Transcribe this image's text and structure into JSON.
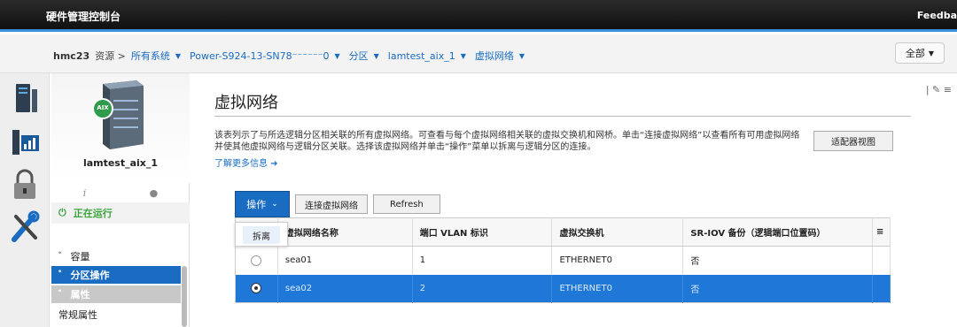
{
  "app": {
    "title": "硬件管理控制台",
    "feedback": "Feedba"
  },
  "breadcrumb": {
    "host": "hmc23",
    "resources": "资源 >",
    "items": [
      "所有系统",
      "Power-S924-13-SN78⁻⁻⁻⁻⁻⁻0",
      "分区",
      "lamtest_aix_1",
      "虚拟网络"
    ]
  },
  "scope": {
    "value": "全部"
  },
  "partition": {
    "name": "lamtest_aix_1",
    "status": "正在运行",
    "badge": "AIX"
  },
  "nav_sections": [
    {
      "label": "容量",
      "icon": "chevron-down"
    },
    {
      "label": "分区操作",
      "icon": "chevron-down"
    },
    {
      "label": "属性",
      "icon": "chevron-up"
    },
    {
      "label": "常规属性",
      "icon": ""
    }
  ],
  "page": {
    "title": "虚拟网络",
    "description": "该表列示了与所选逻辑分区相关联的所有虚拟网络。可查看与每个虚拟网络相关联的虚拟交换机和网桥。单击“连接虚拟网络”以查看所有可用虚拟网络并使其他虚拟网络与逻辑分区关联。选择该虚拟网络并单击“操作”菜单以拆离与逻辑分区的连接。",
    "learn_more": "了解更多信息 ➔",
    "adapter_view": "适配器视图"
  },
  "toolbar": {
    "actions": "操作",
    "connect": "连接虚拟网络",
    "refresh": "Refresh"
  },
  "menu": {
    "detach": "拆离"
  },
  "table": {
    "columns": [
      "",
      "虚拟网络名称",
      "端口 VLAN 标识",
      "虚拟交换机",
      "SR-IOV 备份（逻辑端口位置码）"
    ],
    "rows": [
      {
        "selected": false,
        "name": "sea01",
        "vlan": "1",
        "switch": "ETHERNET0",
        "sriov": "否"
      },
      {
        "selected": true,
        "name": "sea02",
        "vlan": "2",
        "switch": "ETHERNET0",
        "sriov": "否"
      }
    ]
  },
  "colors": {
    "accent": "#1a6cc2",
    "topbar": "#111111",
    "running": "#3aa33a"
  }
}
